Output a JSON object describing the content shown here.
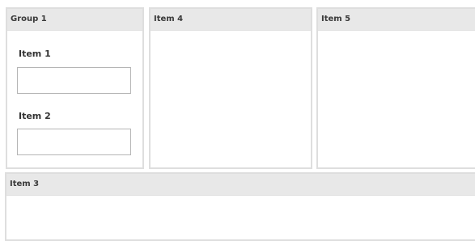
{
  "group1": {
    "title": "Group 1",
    "fields": [
      {
        "label": "Item 1",
        "value": "",
        "placeholder": ""
      },
      {
        "label": "Item 2",
        "value": "",
        "placeholder": ""
      }
    ]
  },
  "item4": {
    "title": "Item 4"
  },
  "item5": {
    "title": "Item 5"
  },
  "item3": {
    "title": "Item 3"
  },
  "colors": {
    "header_background": "#e8e8e8",
    "panel_border": "#dedede",
    "input_border": "#b5b5b5"
  }
}
